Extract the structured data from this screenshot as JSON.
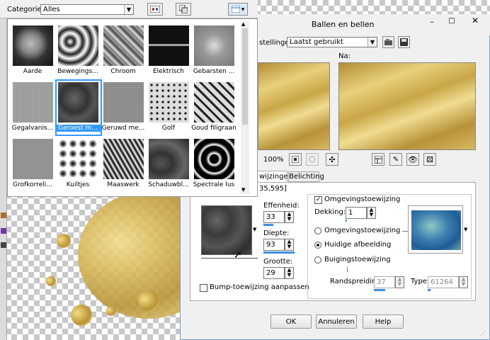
{
  "picker": {
    "category_label": "Categorie:",
    "category_value": "Alles",
    "thumbnails": [
      {
        "label": "Aarde"
      },
      {
        "label": "Bewegings..."
      },
      {
        "label": "Chroom"
      },
      {
        "label": "Elektrisch"
      },
      {
        "label": "Gebarsten ..."
      },
      {
        "label": "Gegalvanis..."
      },
      {
        "label": "Geroest m...",
        "selected": true
      },
      {
        "label": "Geruwd me..."
      },
      {
        "label": "Golf"
      },
      {
        "label": "Goud filigraan"
      },
      {
        "label": "Grofkorreli..."
      },
      {
        "label": "Kuiltjes"
      },
      {
        "label": "Maaswerk"
      },
      {
        "label": "Schaduwbl..."
      },
      {
        "label": "Spectrale lus"
      }
    ]
  },
  "dialog": {
    "title": "Ballen en bellen",
    "settings_label": "stellingen:",
    "settings_value": "Laatst gebruikt",
    "after_label": "Na:",
    "zoom": "100%",
    "tab_maps": "wijzingen",
    "tab_light": "Belichting",
    "coords": "35,595]",
    "effenheid_label": "Effenheid:",
    "effenheid_value": "33",
    "diepte_label": "Diepte:",
    "diepte_value": "93",
    "grootte_label": "Grootte:",
    "grootte_value": "29",
    "bump_label": "Bump-toewijzing aanpassen",
    "omgeving_check_label": "Omgevingstoewijzing",
    "dekking_label": "Dekking:",
    "dekking_value": "1",
    "radio_omgeving": "Omgevingstoewijzing",
    "radio_huidige": "Huidige afbeelding",
    "radio_buiging": "Buigingstoewijzing",
    "randspreiding_label": "Randspreiding:",
    "randspreiding_value": "37",
    "type_label": "Type",
    "type_value": "61264",
    "ok": "OK",
    "cancel": "Annuleren",
    "help": "Help"
  },
  "colors": {
    "accent": "#3d8ee0",
    "selection": "#3399ff"
  }
}
